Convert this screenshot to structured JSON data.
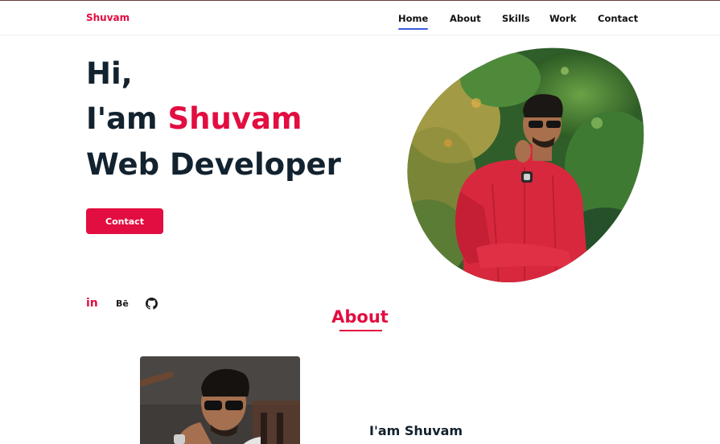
{
  "brand": {
    "name": "Shuvam"
  },
  "nav": {
    "items": [
      {
        "label": "Home",
        "active": true
      },
      {
        "label": "About",
        "active": false
      },
      {
        "label": "Skills",
        "active": false
      },
      {
        "label": "Work",
        "active": false
      },
      {
        "label": "Contact",
        "active": false
      }
    ]
  },
  "hero": {
    "greeting": "Hi,",
    "intro_prefix": "I'am ",
    "intro_name": "Shuvam",
    "role": "Web Developer",
    "cta_label": "Contact"
  },
  "social": {
    "linkedin_label": "in",
    "behance_label": "Bē",
    "github_icon": "github-icon"
  },
  "about": {
    "title": "About",
    "subtitle": "I'am Shuvam"
  },
  "colors": {
    "accent": "#e20d40",
    "text": "#12222f",
    "nav_underline": "#3b5bd9"
  }
}
